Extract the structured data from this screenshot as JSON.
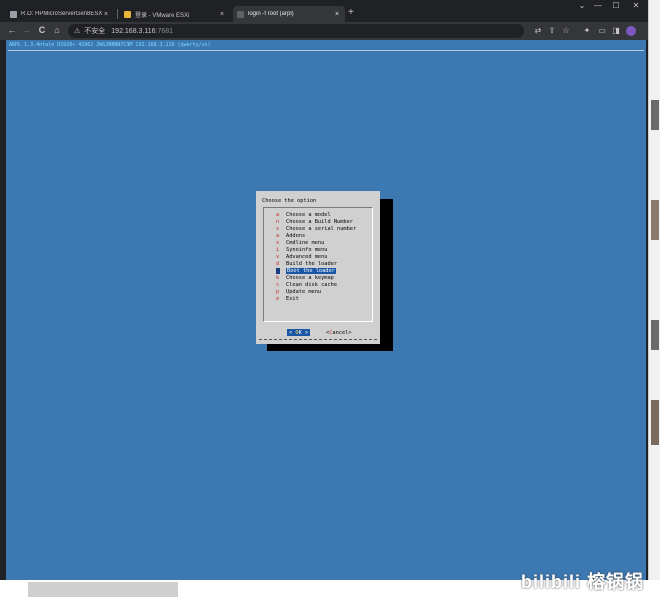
{
  "browser": {
    "tabs": [
      {
        "title": "R.O: HPMicroServerGen8ESXi",
        "close": "×"
      },
      {
        "title": "登录 - VMware ESXi",
        "close": "×"
      },
      {
        "title": "login -f root (arpl)",
        "close": "×"
      }
    ],
    "new_tab": "+",
    "window_controls": {
      "menu": "⌄",
      "minimize": "—",
      "maximize": "☐",
      "close": "✕"
    },
    "nav": {
      "back": "←",
      "forward": "→",
      "reload": "C",
      "home": "⌂"
    },
    "address": {
      "warning_icon": "⚠",
      "security_label": "不安全",
      "host": "192.168.3.116",
      "port": ":7681"
    },
    "toolbar_icons": {
      "translate": "⇄",
      "share": "⇪",
      "bookmark": "☆",
      "extensions": "✦",
      "reading": "▭",
      "sidebar": "◨"
    }
  },
  "terminal": {
    "header": "ARPL 1.3.4ntale DS920+ 42962 2WG3BBNN7C3M 192.168.3.116 (qwerty/us)",
    "dialog": {
      "title": "Choose the option",
      "items": [
        {
          "key": "a",
          "label": "Choose a model"
        },
        {
          "key": "n",
          "label": "Choose a Build Number"
        },
        {
          "key": "s",
          "label": "Choose a serial number"
        },
        {
          "key": "a",
          "label": "Addons"
        },
        {
          "key": "x",
          "label": "Cmdline menu"
        },
        {
          "key": "i",
          "label": "Synoinfo menu"
        },
        {
          "key": "v",
          "label": "Advanced menu"
        },
        {
          "key": "d",
          "label": "Build the loader"
        },
        {
          "key": "",
          "label": "Boot the loader"
        },
        {
          "key": "k",
          "label": "Choose a keymap"
        },
        {
          "key": "c",
          "label": "Clean disk cache"
        },
        {
          "key": "p",
          "label": "Update menu"
        },
        {
          "key": "e",
          "label": "Exit"
        }
      ],
      "ok_button": {
        "left": "< ",
        "hot": "O",
        "rest": "K",
        "right": " >"
      },
      "cancel_button": {
        "left": "<",
        "hot": "C",
        "rest": "ancel",
        "right": ">"
      }
    }
  },
  "watermark": "bilibili 榕锅锅"
}
